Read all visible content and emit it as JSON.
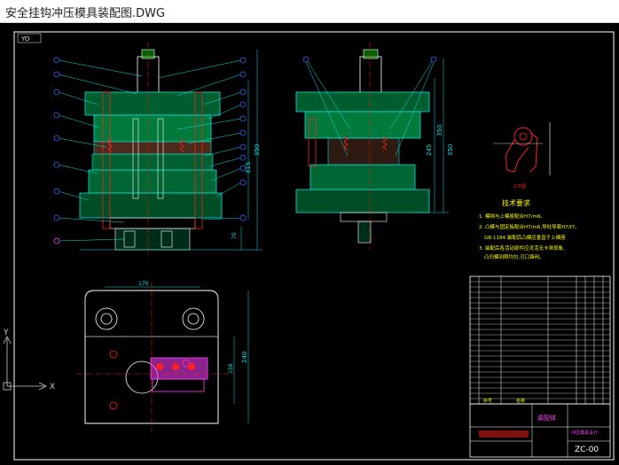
{
  "window": {
    "title": "安全挂钩冲压模具装配图.DWG"
  },
  "drawing": {
    "view_tab": "YO",
    "tech_requirements": {
      "title": "技术要求",
      "lines": [
        "1. 模柄与上模座配合H7/m6。",
        "2. 凸模与固定板配合H7/m6,导柱导套H7/f7。",
        "GB-1184 装配后凸模应垂直于上模座",
        "3. 装配后各活动部件应灵活无卡滞现象,",
        "凸凹模间隙均匀,刃口锋利。"
      ]
    },
    "dimensions": {
      "height_total": "350",
      "height_mid": "315",
      "height_low": "70",
      "side_h1": "245",
      "side_h2": "350",
      "plan_width": "170",
      "plan_h1": "158",
      "plan_h2": "240"
    },
    "axis": {
      "x": "X",
      "y": "Y"
    },
    "title_block": {
      "name": "装配体",
      "drawing_no": "ZC-00",
      "school": "冲压模具设计",
      "col_no": "序号",
      "col_name": "名称"
    },
    "part_label": "工件图",
    "colors": {
      "outline": "#ffffff",
      "cyan": "#00e5e5",
      "green": "#00c000",
      "red": "#ff2020",
      "blue": "#4060ff",
      "yellow": "#ffff00",
      "magenta": "#ff40ff"
    }
  }
}
